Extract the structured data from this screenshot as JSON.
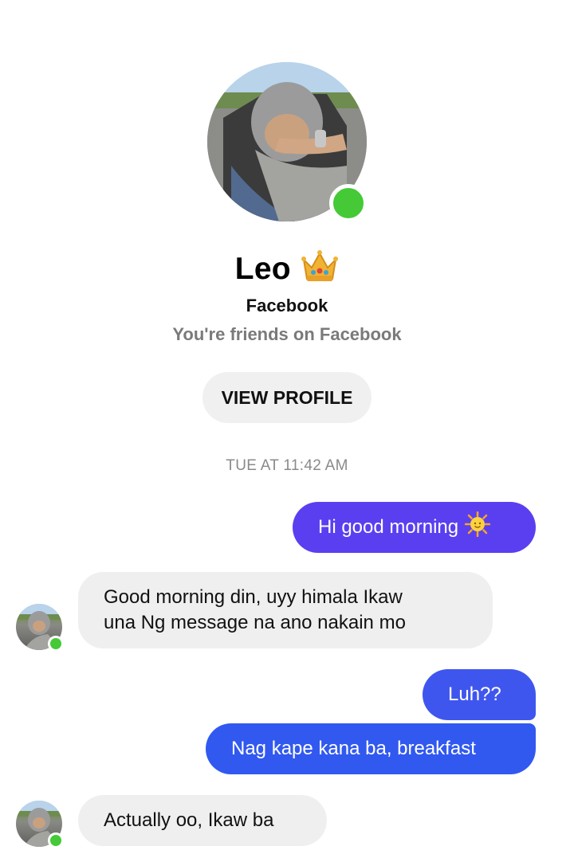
{
  "contact": {
    "name": "Leo",
    "source": "Facebook",
    "relationship": "You're friends on Facebook",
    "online": true
  },
  "view_profile_label": "VIEW PROFILE",
  "timestamp": "TUE AT 11:42 AM",
  "messages": [
    {
      "direction": "outgoing",
      "text": "Hi good morning",
      "emoji": "sun-icon"
    },
    {
      "direction": "incoming",
      "text_lines": [
        "Good morning din, uyy himala Ikaw",
        "una Ng message na ano nakain mo"
      ]
    },
    {
      "direction": "outgoing",
      "text": "Luh??"
    },
    {
      "direction": "outgoing",
      "text": "Nag kape kana ba, breakfast"
    },
    {
      "direction": "incoming",
      "text": "Actually oo, Ikaw ba"
    }
  ],
  "colors": {
    "online_dot": "#45c937",
    "outgoing_bubble_1": "#5a3ff0",
    "outgoing_bubble_2": "#3f56ee",
    "outgoing_bubble_3": "#3159f0",
    "incoming_bubble": "#efefef"
  }
}
